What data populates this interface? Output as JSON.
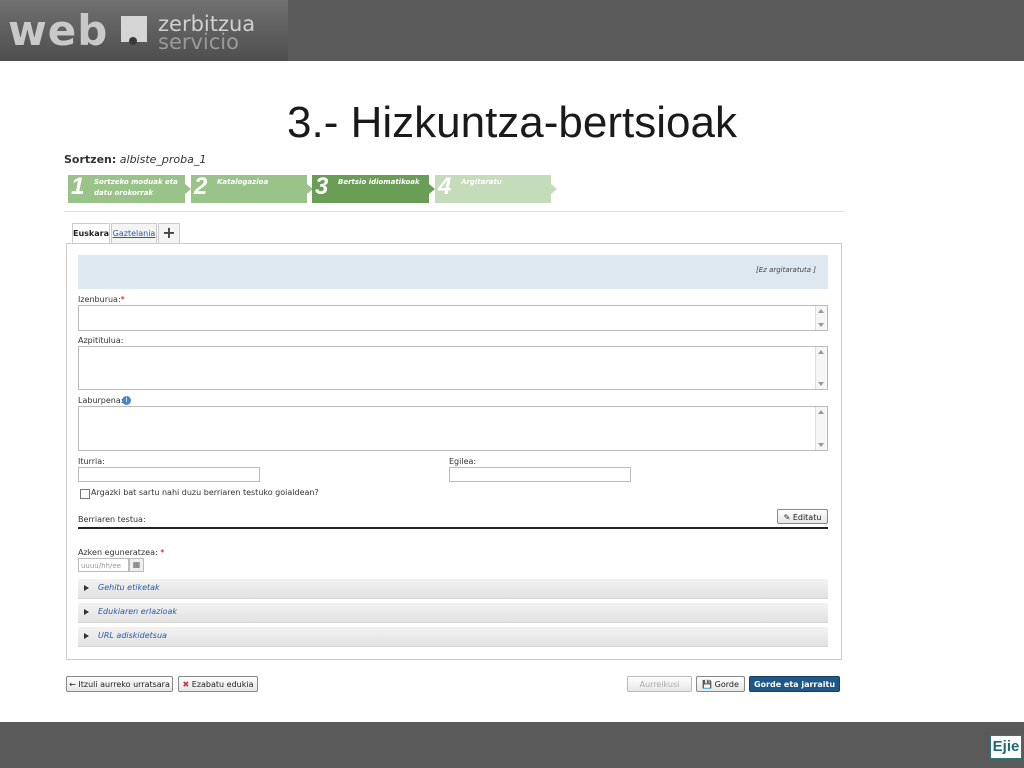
{
  "header": {
    "logo_web": "web",
    "logo_line1": "zerbitzua",
    "logo_line2": "servicio"
  },
  "slide_title": "3.- Hizkuntza-bertsioak",
  "form": {
    "sortzen_label": "Sortzen:",
    "sortzen_value": "albiste_proba_1",
    "steps": [
      {
        "num": "1",
        "label": "Sortzeko moduak eta datu orokorrak"
      },
      {
        "num": "2",
        "label": "Katalogazioa"
      },
      {
        "num": "3",
        "label": "Bertsio idiomatikoak"
      },
      {
        "num": "4",
        "label": "Argitaratu"
      }
    ],
    "tabs": {
      "active": "Euskara",
      "other": "Gaztelania",
      "add": "+"
    },
    "status": "[Ez argitaratuta ]",
    "labels": {
      "izenburua": "Izenburua:",
      "azpititulua": "Azpititulua:",
      "laburpena": "Laburpena:",
      "iturria": "Iturria:",
      "egilea": "Egilea:",
      "checkbox": "Argazki bat sartu nahi duzu berriaren testuko goialdean?",
      "berriaren_testua": "Berriaren testua:",
      "azken_eguneratzea": "Azken eguneratzea:"
    },
    "required_mark": "*",
    "editatu": "Editatu",
    "date_placeholder": "uuuu/hh/ee",
    "accordions": [
      "Gehitu etiketak",
      "Edukiaren erlazioak",
      "URL adiskidetsua"
    ]
  },
  "buttons": {
    "back": "← Itzuli aurreko urratsara",
    "delete": "Ezabatu edukia",
    "preview": "Aurreikusi",
    "save": "Gorde",
    "save_continue": "Gorde eta jarraitu →"
  },
  "footer": {
    "logo": "Ejie"
  },
  "colors": {
    "step_active": "#6a9e57",
    "step_inactive": "#9ac38a",
    "step_disabled": "#c4dcba",
    "primary": "#1f5788"
  }
}
